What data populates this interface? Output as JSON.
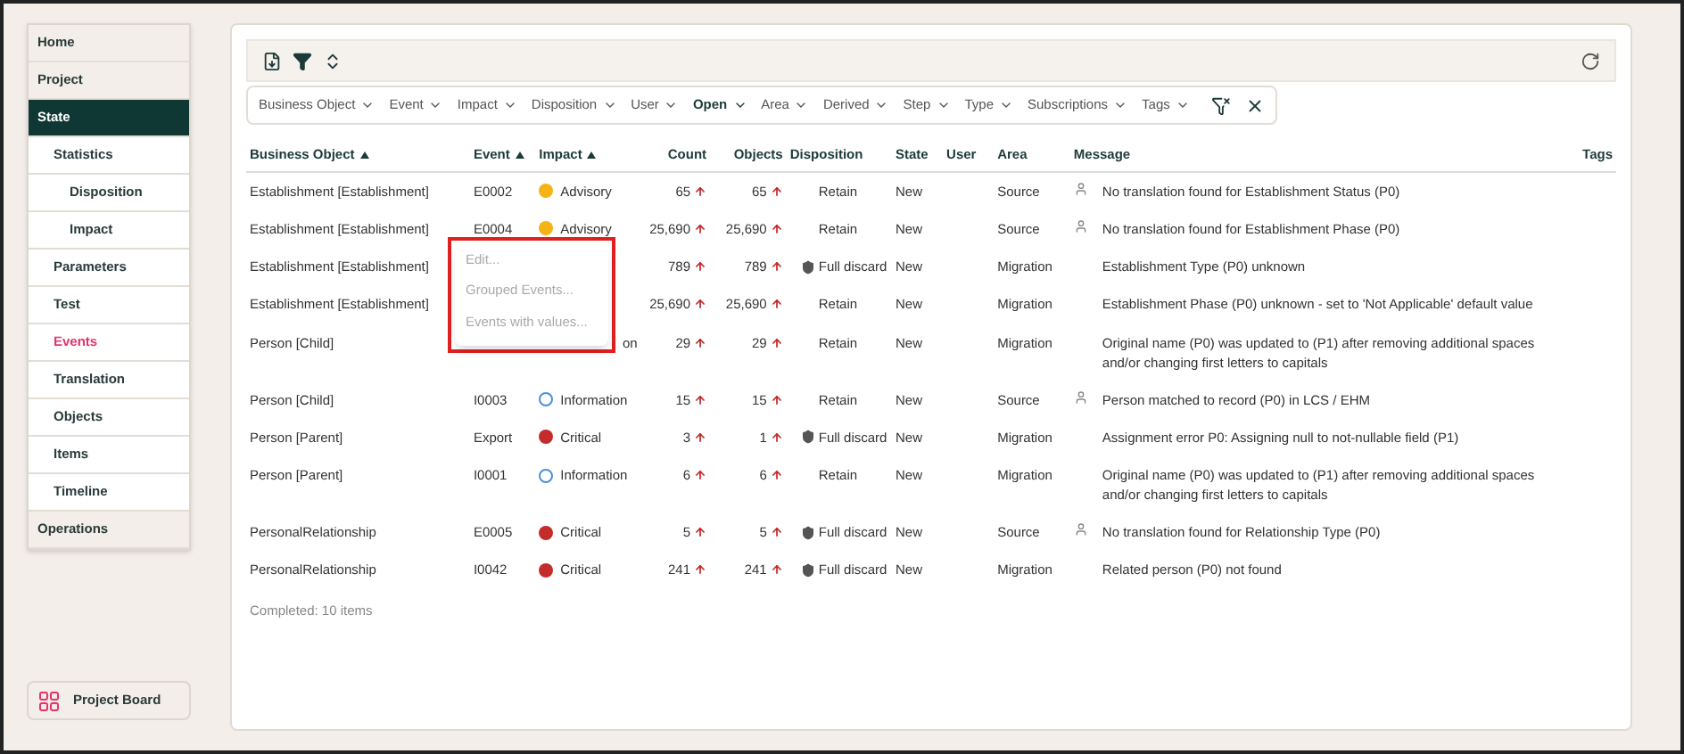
{
  "sidebar": {
    "items": [
      {
        "label": "Home",
        "selected": false
      },
      {
        "label": "Project",
        "selected": false
      },
      {
        "label": "State",
        "selected": true,
        "children": [
          {
            "label": "Statistics",
            "selected": false,
            "children": [
              {
                "label": "Disposition",
                "selected": false
              },
              {
                "label": "Impact",
                "selected": false
              }
            ]
          },
          {
            "label": "Parameters",
            "selected": false
          },
          {
            "label": "Test",
            "selected": false
          },
          {
            "label": "Events",
            "selected": true
          },
          {
            "label": "Translation",
            "selected": false
          },
          {
            "label": "Objects",
            "selected": false
          },
          {
            "label": "Items",
            "selected": false
          },
          {
            "label": "Timeline",
            "selected": false
          }
        ]
      },
      {
        "label": "Operations",
        "selected": false
      }
    ],
    "footer_button": "Project Board"
  },
  "filters": [
    {
      "label": "Business Object",
      "active": false
    },
    {
      "label": "Event",
      "active": false
    },
    {
      "label": "Impact",
      "active": false
    },
    {
      "label": "Disposition",
      "active": false
    },
    {
      "label": "User",
      "active": false
    },
    {
      "label": "Open",
      "active": true
    },
    {
      "label": "Area",
      "active": false
    },
    {
      "label": "Derived",
      "active": false
    },
    {
      "label": "Step",
      "active": false
    },
    {
      "label": "Type",
      "active": false
    },
    {
      "label": "Subscriptions",
      "active": false
    },
    {
      "label": "Tags",
      "active": false
    }
  ],
  "table": {
    "columns": [
      {
        "label": "Business Object",
        "sorted": true
      },
      {
        "label": "Event",
        "sorted": true
      },
      {
        "label": "Impact",
        "sorted": true
      },
      {
        "label": "Count",
        "sorted": false
      },
      {
        "label": "Objects",
        "sorted": false
      },
      {
        "label": "Disposition",
        "sorted": false
      },
      {
        "label": "State",
        "sorted": false
      },
      {
        "label": "User",
        "sorted": false
      },
      {
        "label": "Area",
        "sorted": false
      },
      {
        "label": "Message",
        "sorted": false
      },
      {
        "label": "Tags",
        "sorted": false
      }
    ],
    "rows": [
      {
        "object": "Establishment [Establishment]",
        "event": "E0002",
        "impact": {
          "kind": "advisory",
          "label": "Advisory"
        },
        "count": "65",
        "objects": "65",
        "disposition": {
          "kind": "retain",
          "label": "Retain"
        },
        "state": "New",
        "area": "Source",
        "user": true,
        "message": "No translation found for Establishment Status (P0)"
      },
      {
        "object": "Establishment [Establishment]",
        "event": "E0004",
        "impact": {
          "kind": "advisory",
          "label": "Advisory"
        },
        "count": "25,690",
        "objects": "25,690",
        "disposition": {
          "kind": "retain",
          "label": "Retain"
        },
        "state": "New",
        "area": "Source",
        "user": true,
        "message": "No translation found for Establishment Phase (P0)"
      },
      {
        "object": "Establishment [Establishment]",
        "count": "789",
        "objects": "789",
        "disposition": {
          "kind": "discard",
          "label": "Full discard"
        },
        "state": "New",
        "area": "Migration",
        "user": false,
        "message": "Establishment Type (P0) unknown"
      },
      {
        "object": "Establishment [Establishment]",
        "count": "25,690",
        "objects": "25,690",
        "disposition": {
          "kind": "retain",
          "label": "Retain"
        },
        "state": "New",
        "area": "Migration",
        "user": false,
        "message": "Establishment Phase (P0) unknown - set to 'Not Applicable' default value"
      },
      {
        "object": "Person [Child]",
        "impact": {
          "kind": "hidden",
          "label": "on"
        },
        "count": "29",
        "objects": "29",
        "disposition": {
          "kind": "retain",
          "label": "Retain"
        },
        "state": "New",
        "area": "Migration",
        "user": false,
        "message": "Original name (P0) was updated to (P1) after removing additional spaces and/or changing first letters to capitals"
      },
      {
        "object": "Person [Child]",
        "event": "I0003",
        "impact": {
          "kind": "information",
          "label": "Information"
        },
        "count": "15",
        "objects": "15",
        "disposition": {
          "kind": "retain",
          "label": "Retain"
        },
        "state": "New",
        "area": "Source",
        "user": true,
        "message": "Person matched to record (P0) in LCS / EHM"
      },
      {
        "object": "Person [Parent]",
        "event": "Export",
        "impact": {
          "kind": "critical",
          "label": "Critical"
        },
        "count": "3",
        "objects": "1",
        "disposition": {
          "kind": "discard",
          "label": "Full discard"
        },
        "state": "New",
        "area": "Migration",
        "user": false,
        "message": "Assignment error P0: Assigning null to not-nullable field (P1)"
      },
      {
        "object": "Person [Parent]",
        "event": "I0001",
        "impact": {
          "kind": "information",
          "label": "Information"
        },
        "count": "6",
        "objects": "6",
        "disposition": {
          "kind": "retain",
          "label": "Retain"
        },
        "state": "New",
        "area": "Migration",
        "user": false,
        "message": "Original name (P0) was updated to (P1) after removing additional spaces and/or changing first letters to capitals"
      },
      {
        "object": "PersonalRelationship",
        "event": "E0005",
        "impact": {
          "kind": "critical",
          "label": "Critical"
        },
        "count": "5",
        "objects": "5",
        "disposition": {
          "kind": "discard",
          "label": "Full discard"
        },
        "state": "New",
        "area": "Source",
        "user": true,
        "message": "No translation found for Relationship Type (P0)"
      },
      {
        "object": "PersonalRelationship",
        "event": "I0042",
        "impact": {
          "kind": "critical",
          "label": "Critical"
        },
        "count": "241",
        "objects": "241",
        "disposition": {
          "kind": "discard",
          "label": "Full discard"
        },
        "state": "New",
        "area": "Migration",
        "user": false,
        "message": "Related person (P0) not found"
      }
    ],
    "status": "Completed: 10 items"
  },
  "context_menu": {
    "highlighted": true,
    "items": [
      {
        "label": "Edit...",
        "disabled": true
      },
      {
        "label": "Grouped Events...",
        "disabled": true
      },
      {
        "label": "Events with values...",
        "disabled": true
      }
    ]
  }
}
